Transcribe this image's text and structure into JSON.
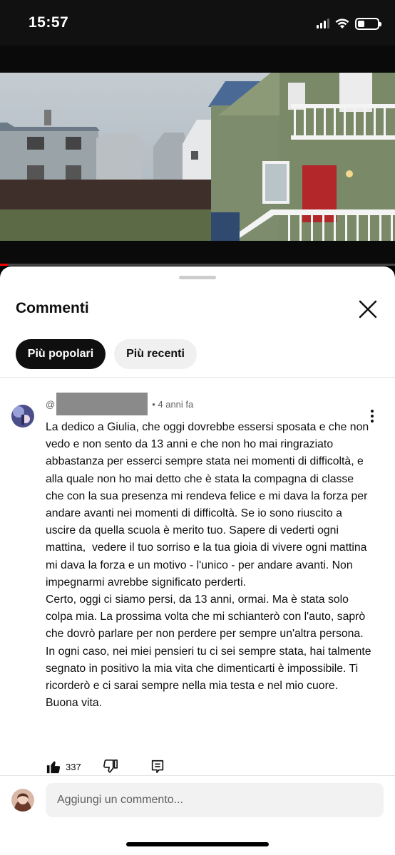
{
  "status_bar": {
    "time": "15:57",
    "battery_level": 0.35
  },
  "video": {
    "progress": 0.02,
    "progress_color": "#ee0000"
  },
  "comments_panel": {
    "title": "Commenti",
    "close_icon": "close-icon",
    "filters": [
      {
        "label": "Più popolari",
        "selected": true
      },
      {
        "label": "Più recenti",
        "selected": false
      }
    ],
    "comment": {
      "author_prefix": "@",
      "timestamp": "• 4 anni fa",
      "text": "La dedico a Giulia, che oggi dovrebbe essersi sposata e che non vedo e non sento da 13 anni e che non ho mai ringraziato abbastanza per esserci sempre stata nei momenti di difficoltà, e alla quale non ho mai detto che è stata la compagna di classe che con la sua presenza mi rendeva felice e mi dava la forza per andare avanti nei momenti di difficoltà. Se io sono riuscito a uscire da quella scuola è merito tuo. Sapere di vederti ogni mattina,  vedere il tuo sorriso e la tua gioia di vivere ogni mattina mi dava la forza e un motivo - l'unico - per andare avanti. Non impegnarmi avrebbe significato perderti.\nCerto, oggi ci siamo persi, da 13 anni, ormai. Ma è stata solo colpa mia. La prossima volta che mi schianterò con l'auto, saprò che dovrò parlare per non perdere per sempre un'altra persona. In ogni caso, nei miei pensieri tu ci sei sempre stata, hai talmente segnato in positivo la mia vita che dimenticarti è impossibile. Ti ricorderò e ci sarai sempre nella mia testa e nel mio cuore.\nBuona vita.",
      "likes": "337"
    },
    "add_comment": {
      "placeholder": "Aggiungi un commento..."
    }
  }
}
